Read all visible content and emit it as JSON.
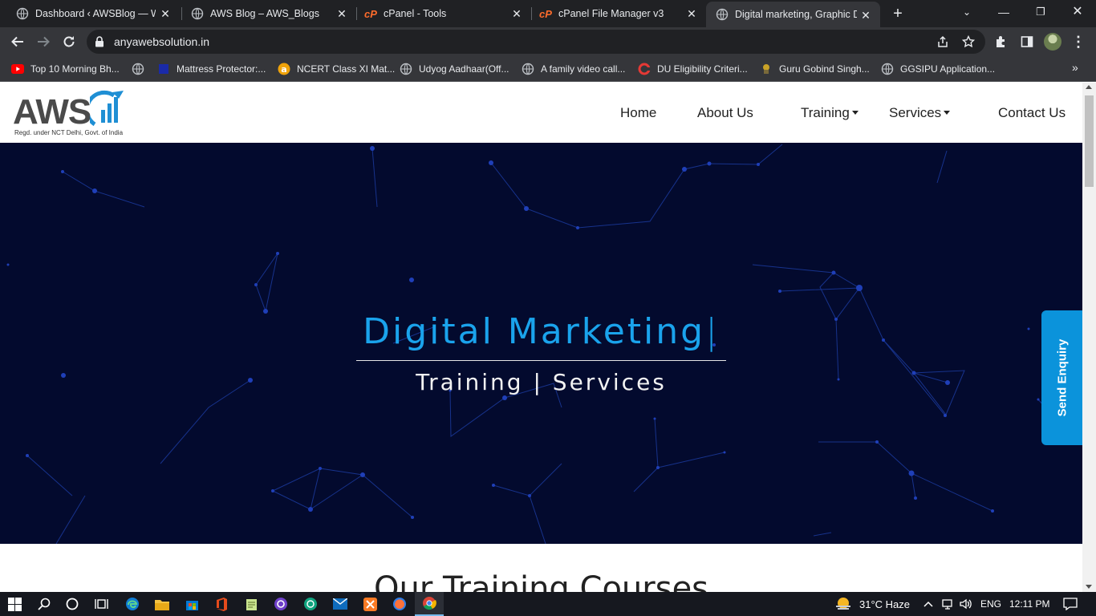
{
  "browser": {
    "tabs": [
      {
        "title": "Dashboard ‹ AWSBlog — Wo",
        "icon": "globe-icon"
      },
      {
        "title": "AWS Blog – AWS_Blogs",
        "icon": "globe-icon"
      },
      {
        "title": "cPanel - Tools",
        "icon": "cpanel-icon"
      },
      {
        "title": "cPanel File Manager v3",
        "icon": "cpanel-icon"
      },
      {
        "title": "Digital marketing, Graphic De",
        "icon": "globe-icon",
        "active": true
      }
    ],
    "url": "anyawebsolution.in",
    "bookmarks": [
      {
        "label": "Top 10 Morning Bh...",
        "icon": "youtube-icon"
      },
      {
        "label": "",
        "icon": "globe-icon"
      },
      {
        "label": "Mattress Protector:...",
        "icon": "bookmark-flag-icon"
      },
      {
        "label": "NCERT Class XI Mat...",
        "icon": "orange-a-icon"
      },
      {
        "label": "Udyog Aadhaar(Off...",
        "icon": "globe-icon"
      },
      {
        "label": "A family video call...",
        "icon": "globe-icon"
      },
      {
        "label": "DU Eligibility Criteri...",
        "icon": "red-c-icon"
      },
      {
        "label": "Guru Gobind Singh...",
        "icon": "emblem-icon"
      },
      {
        "label": "GGSIPU Application...",
        "icon": "globe-icon"
      }
    ]
  },
  "site": {
    "logo": {
      "word": "AWS",
      "tagline": "Regd. under NCT Delhi, Govt. of India"
    },
    "nav": {
      "home": "Home",
      "about": "About Us",
      "training": "Training",
      "services": "Services",
      "contact": "Contact Us"
    },
    "hero": {
      "title": "Digital Marketing",
      "cursor": "|",
      "subtitle": "Training | Services"
    },
    "enquiry_button": "Send Enquiry",
    "section_title": "Our Training Courses"
  },
  "taskbar": {
    "weather": "31°C  Haze",
    "language": "ENG",
    "time": "12:11 PM"
  },
  "colors": {
    "hero_bg": "#030a2e",
    "hero_title": "#1aa3ec",
    "enquiry_bg": "#0b93db",
    "network_line": "#1b3a9c"
  }
}
